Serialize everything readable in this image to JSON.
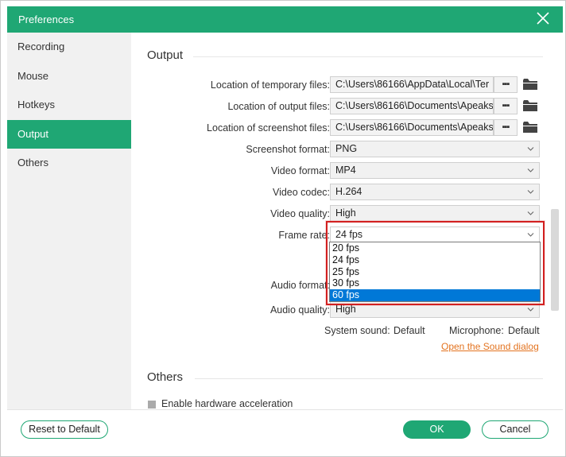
{
  "window": {
    "title": "Preferences"
  },
  "sidebar": {
    "items": [
      {
        "label": "Recording"
      },
      {
        "label": "Mouse"
      },
      {
        "label": "Hotkeys"
      },
      {
        "label": "Output"
      },
      {
        "label": "Others"
      }
    ]
  },
  "output": {
    "section_title": "Output",
    "temp_files": {
      "label": "Location of temporary files:",
      "value": "C:\\Users\\86166\\AppData\\Local\\Ter",
      "browse": "▪▪▪"
    },
    "output_files": {
      "label": "Location of output files:",
      "value": "C:\\Users\\86166\\Documents\\Apeaks",
      "browse": "▪▪▪"
    },
    "screenshot_files": {
      "label": "Location of screenshot files:",
      "value": "C:\\Users\\86166\\Documents\\Apeaks",
      "browse": "▪▪▪"
    },
    "screenshot_format": {
      "label": "Screenshot format:",
      "value": "PNG"
    },
    "video_format": {
      "label": "Video format:",
      "value": "MP4"
    },
    "video_codec": {
      "label": "Video codec:",
      "value": "H.264"
    },
    "video_quality": {
      "label": "Video quality:",
      "value": "High"
    },
    "frame_rate": {
      "label": "Frame rate:",
      "value": "24 fps",
      "options": [
        "20 fps",
        "24 fps",
        "25 fps",
        "30 fps",
        "60 fps"
      ],
      "highlighted": "60 fps"
    },
    "audio_format": {
      "label": "Audio format:"
    },
    "audio_quality": {
      "label": "Audio quality:",
      "value": "High"
    },
    "system_sound": {
      "label": "System sound:",
      "value": "Default"
    },
    "microphone": {
      "label": "Microphone:",
      "value": "Default"
    },
    "sound_dialog_link": "Open the Sound dialog"
  },
  "others": {
    "section_title": "Others",
    "hardware_accel": "Enable hardware acceleration"
  },
  "footer": {
    "reset": "Reset to Default",
    "ok": "OK",
    "cancel": "Cancel"
  },
  "colors": {
    "accent": "#1fa774",
    "link": "#e3731f",
    "selection": "#0078d7",
    "highlight_frame": "#d22020"
  }
}
